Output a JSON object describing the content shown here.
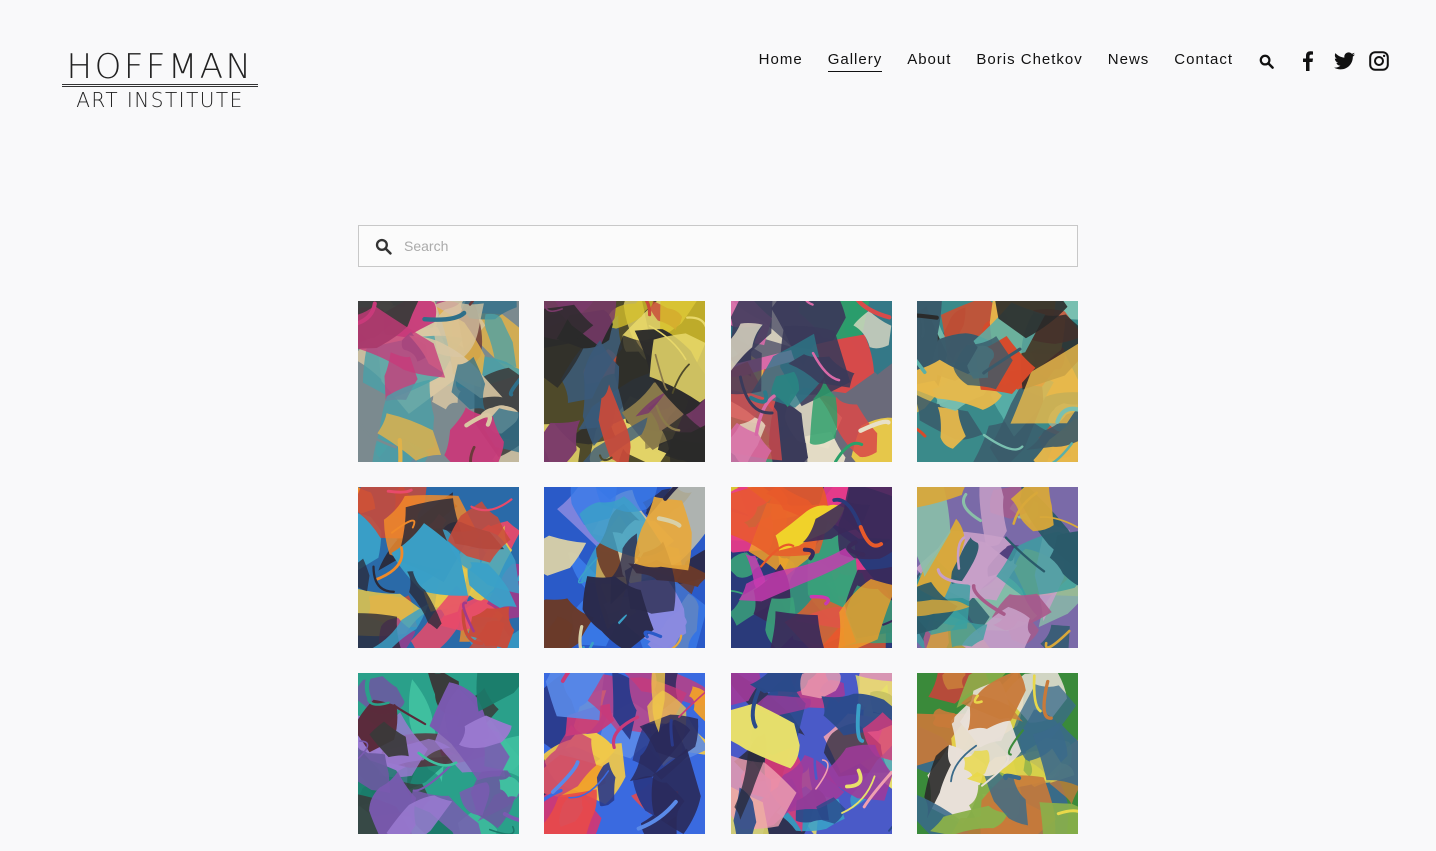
{
  "site": {
    "logo_line1": "HOFFMAN",
    "logo_line2": "ART INSTITUTE"
  },
  "nav": {
    "items": [
      {
        "label": "Home",
        "active": false
      },
      {
        "label": "Gallery",
        "active": true
      },
      {
        "label": "About",
        "active": false
      },
      {
        "label": "Boris Chetkov",
        "active": false
      },
      {
        "label": "News",
        "active": false
      },
      {
        "label": "Contact",
        "active": false
      }
    ],
    "icons": [
      "search-icon",
      "facebook-icon",
      "twitter-icon",
      "instagram-icon"
    ]
  },
  "search": {
    "placeholder": "Search",
    "value": ""
  },
  "gallery": {
    "tiles": [
      {
        "palette": [
          "#7b8a8f",
          "#2e6f8a",
          "#c83a7a",
          "#d9c7a3",
          "#3a3a3a",
          "#4aa0a8",
          "#e0b24a",
          "#6b3a3a"
        ]
      },
      {
        "palette": [
          "#4f4a2a",
          "#d8c22a",
          "#7a3a6a",
          "#2a2a2a",
          "#e8d86a",
          "#3a5a7a",
          "#c84a3a",
          "#8a7a4a"
        ]
      },
      {
        "palette": [
          "#6a6a7a",
          "#d84a4a",
          "#2a7a8a",
          "#e8e0c8",
          "#3a3a5a",
          "#d86aa8",
          "#2aa06a",
          "#e8c84a"
        ]
      },
      {
        "palette": [
          "#3a8a8a",
          "#5ab0a8",
          "#2a2a2a",
          "#c8a04a",
          "#d84a2a",
          "#3a5a6a",
          "#e8b84a",
          "#7ac0b0"
        ]
      },
      {
        "palette": [
          "#2a6aa8",
          "#e84a6a",
          "#f08a2a",
          "#3aa0c8",
          "#a03a8a",
          "#2a2a3a",
          "#e8c84a",
          "#c84a3a"
        ]
      },
      {
        "palette": [
          "#2a5ac8",
          "#3a7ae8",
          "#e8a83a",
          "#6a3a2a",
          "#3aa0c8",
          "#8a8ae0",
          "#2a2a4a",
          "#d8d0a8"
        ]
      },
      {
        "palette": [
          "#2a3a7a",
          "#e83a8a",
          "#f0d82a",
          "#3a2a5a",
          "#e85a2a",
          "#3aa07a",
          "#c83ab0",
          "#f0a02a"
        ]
      },
      {
        "palette": [
          "#7a6aa8",
          "#3aa0a0",
          "#c8a0c8",
          "#d8a83a",
          "#4a3a7a",
          "#8ac0a8",
          "#2a5a6a",
          "#a85a8a"
        ]
      },
      {
        "palette": [
          "#2aa08a",
          "#7a5ab0",
          "#3a3a3a",
          "#40c0a0",
          "#9a7ad0",
          "#5a2a3a",
          "#1a7a6a",
          "#6a5aa0"
        ]
      },
      {
        "palette": [
          "#3a6ae0",
          "#f0a02a",
          "#e84a4a",
          "#2a3a8a",
          "#f0c84a",
          "#c83a7a",
          "#5a8ae8",
          "#2a2a5a"
        ]
      },
      {
        "palette": [
          "#4a5ac8",
          "#e8e06a",
          "#d83a7a",
          "#2a2a3a",
          "#3aa0c8",
          "#a03a9a",
          "#f0a0b0",
          "#2a4a8a"
        ]
      },
      {
        "palette": [
          "#3a8a3a",
          "#d83a3a",
          "#e8d84a",
          "#2a2a2a",
          "#e8e0d8",
          "#3a6a8a",
          "#c87a3a",
          "#8ab04a"
        ]
      }
    ]
  }
}
